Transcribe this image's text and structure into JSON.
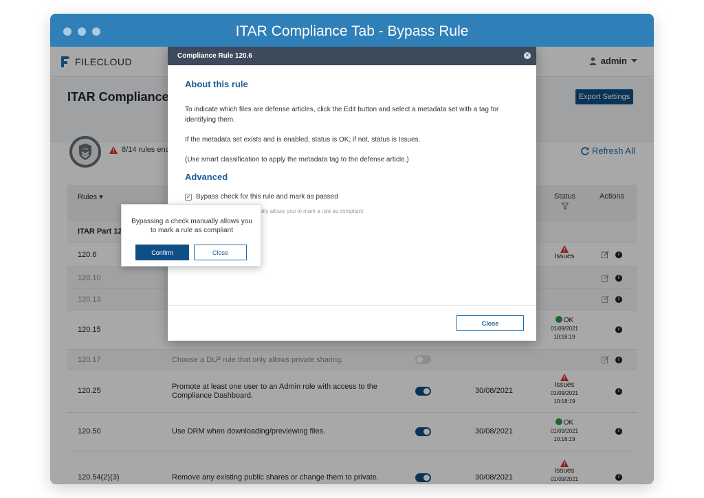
{
  "window": {
    "title": "ITAR Compliance Tab - Bypass Rule"
  },
  "brand": {
    "name": "FILECLOUD"
  },
  "user": {
    "name": "admin"
  },
  "page": {
    "title": "ITAR Compliance",
    "export_label": "Export Settings",
    "summary_text": "8/14 rules ena",
    "refresh_label": "Refresh All",
    "badge_text": "ITAR"
  },
  "table": {
    "headers": {
      "rules": "Rules",
      "status": "Status",
      "actions": "Actions"
    },
    "group_label": "ITAR Part 120",
    "rows": [
      {
        "id": "120.6",
        "desc": "",
        "muted": false,
        "status": "Issues",
        "date": "",
        "time": "",
        "editable": true
      },
      {
        "id": "120.10",
        "desc": "",
        "muted": true,
        "status": "",
        "date": "",
        "time": "",
        "editable": true
      },
      {
        "id": "120.13",
        "desc": "",
        "muted": true,
        "status": "",
        "date": "",
        "time": "",
        "editable": true
      },
      {
        "id": "120.15",
        "desc": "",
        "muted": false,
        "status": "OK",
        "date": "01/09/2021",
        "time": "10:18:19",
        "editable": false
      },
      {
        "id": "120.17",
        "desc": "Choose a DLP rule that only allows private sharing.",
        "muted": true,
        "toggle": "off",
        "status": "",
        "date": "",
        "time": "",
        "editable": true
      },
      {
        "id": "120.25",
        "desc": "Promote at least one user to an Admin role with access to the Compliance Dashboard.",
        "muted": false,
        "toggle": "on",
        "enabled_date": "30/08/2021",
        "status": "Issues",
        "date": "01/09/2021",
        "time": "10:18:19",
        "editable": false
      },
      {
        "id": "120.50",
        "desc": "Use DRM when downloading/previewing files.",
        "muted": false,
        "toggle": "on",
        "enabled_date": "30/08/2021",
        "status": "OK",
        "date": "01/09/2021",
        "time": "10:18:19",
        "editable": false
      },
      {
        "id": "120.54(2)(3)",
        "desc": "Remove any existing public shares or change them to private.",
        "muted": false,
        "toggle": "on",
        "enabled_date": "30/08/2021",
        "status": "Issues",
        "date": "01/09/2021",
        "time": "",
        "editable": false
      }
    ]
  },
  "modal": {
    "title": "Compliance Rule 120.6",
    "about_heading": "About this rule",
    "para1": "To indicate which files are defense articles, click the Edit button and select a metadata set with a tag for identifying them.",
    "para2": "If the metadata set exists and is enabled, status is OK; if not, status is Issues.",
    "para3": "(Use smart classification to apply the metadata tag to the defense article.)",
    "advanced_heading": "Advanced",
    "bypass_label": "Bypass check for this rule and mark as passed",
    "bypass_hint": "ually allows you to mark a rule as compliant",
    "close_label": "Close"
  },
  "popover": {
    "text": "Bypassing a check manually allows you to mark a rule as compliant",
    "confirm_label": "Confirm",
    "close_label": "Close"
  },
  "colors": {
    "titlebar": "#2f7fb8",
    "primary": "#0f4f86",
    "link": "#1b6fb5",
    "danger": "#d32f2f",
    "ok": "#2e9b3d"
  }
}
